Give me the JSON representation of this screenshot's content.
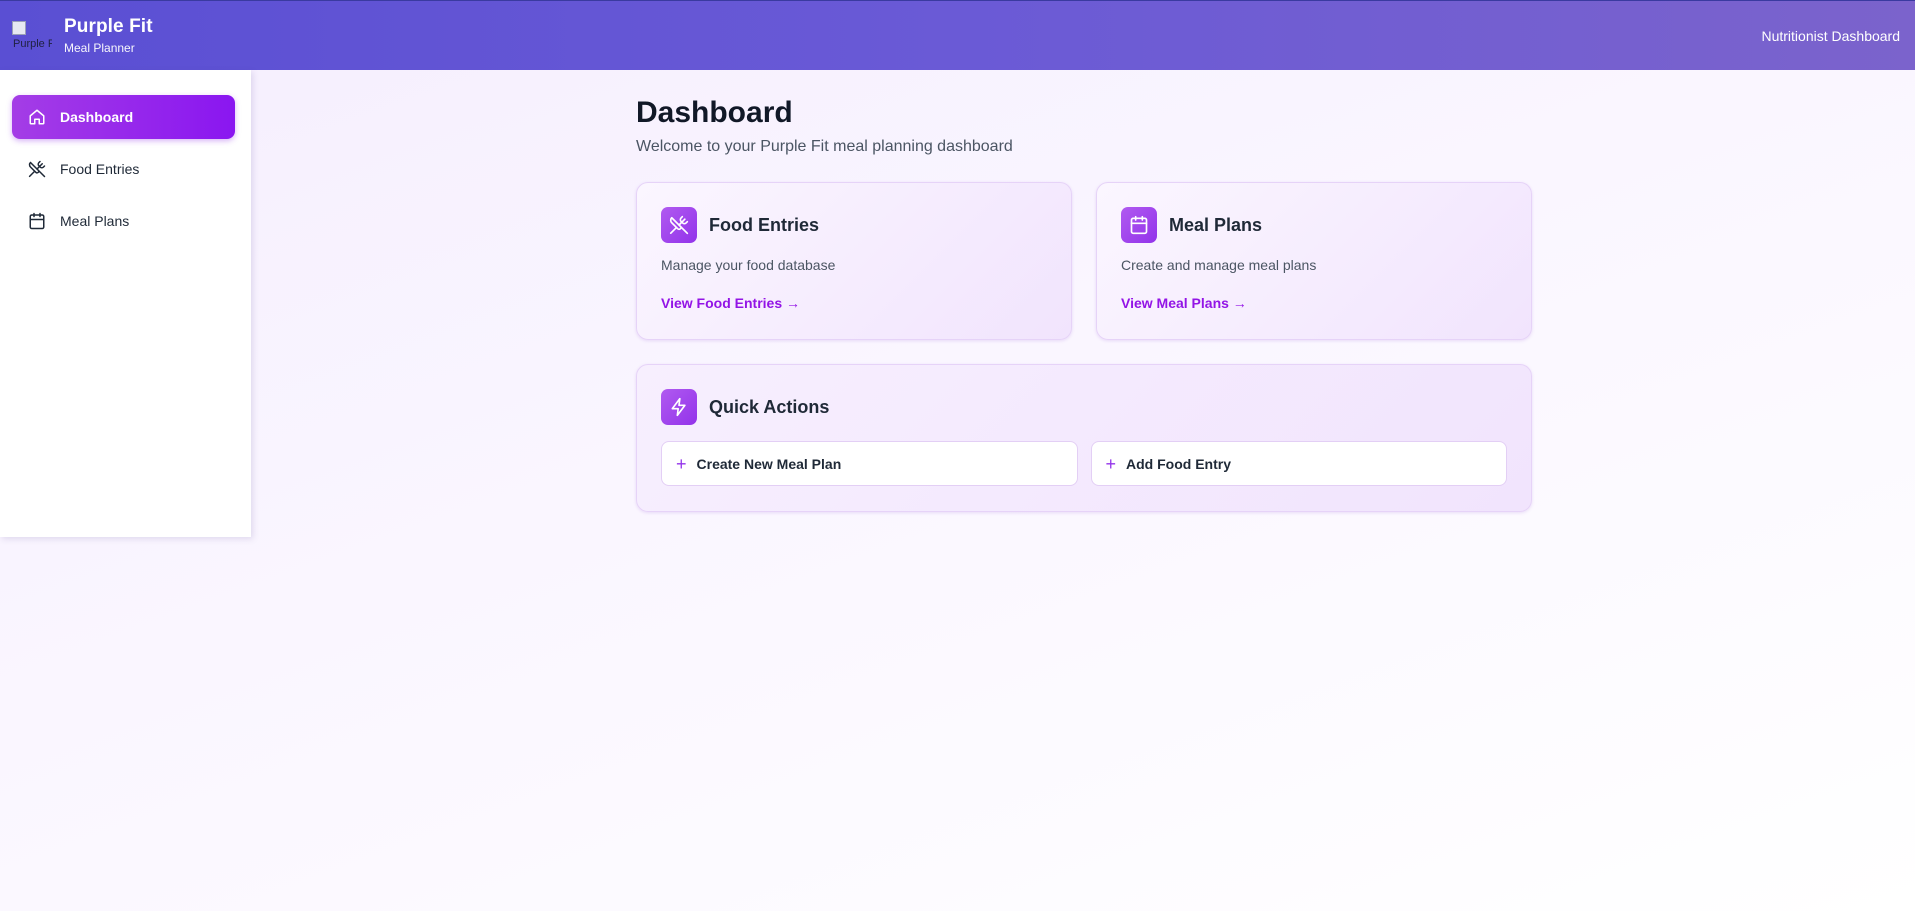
{
  "header": {
    "logo_alt": "Purple Fit",
    "app_title": "Purple Fit",
    "app_subtitle": "Meal Planner",
    "role_label": "Nutritionist Dashboard"
  },
  "sidebar": {
    "items": [
      {
        "label": "Dashboard",
        "icon": "home-icon",
        "active": true
      },
      {
        "label": "Food Entries",
        "icon": "utensils-icon",
        "active": false
      },
      {
        "label": "Meal Plans",
        "icon": "calendar-icon",
        "active": false
      }
    ]
  },
  "main": {
    "title": "Dashboard",
    "subtitle": "Welcome to your Purple Fit meal planning dashboard",
    "cards": [
      {
        "title": "Food Entries",
        "description": "Manage your food database",
        "link": "View Food Entries →",
        "icon": "utensils-icon"
      },
      {
        "title": "Meal Plans",
        "description": "Create and manage meal plans",
        "link": "View Meal Plans →",
        "icon": "calendar-icon"
      }
    ],
    "quick_actions": {
      "title": "Quick Actions",
      "icon": "lightning-icon",
      "buttons": [
        {
          "label": "Create New Meal Plan",
          "icon": "plus-icon"
        },
        {
          "label": "Add Food Entry",
          "icon": "plus-icon"
        }
      ]
    }
  },
  "colors": {
    "header_gradient_start": "#5a4fd3",
    "header_gradient_end": "#7b63cc",
    "accent": "#9333ea",
    "link": "#9314e6"
  }
}
